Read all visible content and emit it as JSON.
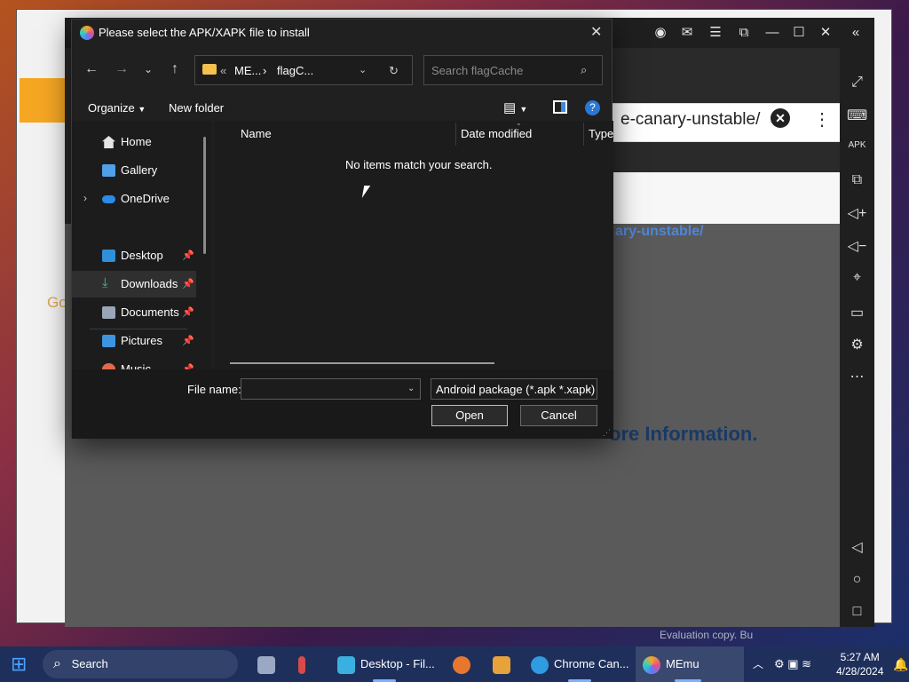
{
  "dialog": {
    "title": "Please select the APK/XAPK file to install",
    "close": "✕",
    "address": {
      "part1": "ME...",
      "part2": "flagC..."
    },
    "search_placeholder": "Search flagCache",
    "toolbar": {
      "organize": "Organize",
      "new_folder": "New folder"
    },
    "nav_items": [
      {
        "label": "Home"
      },
      {
        "label": "Gallery"
      },
      {
        "label": "OneDrive"
      },
      {
        "label": "Desktop"
      },
      {
        "label": "Downloads"
      },
      {
        "label": "Documents"
      },
      {
        "label": "Pictures"
      },
      {
        "label": "Music"
      }
    ],
    "columns": {
      "name": "Name",
      "date": "Date modified",
      "type": "Type"
    },
    "empty_message": "No items match your search.",
    "file_name_label": "File name:",
    "file_name_value": "",
    "file_type": "Android package (*.apk *.xapk)",
    "open": "Open",
    "cancel": "Cancel"
  },
  "memu": {
    "url_text": "e-canary-unstable/",
    "link_text": "ary-unstable/",
    "more_info": "ore Information.",
    "eval": "Evaluation copy. Bu"
  },
  "background": {
    "go_text": "Go"
  },
  "taskbar": {
    "search": "Search",
    "items": [
      "Desktop - Fil...",
      "Chrome Can...",
      "MEmu"
    ],
    "time": "5:27 AM",
    "date": "4/28/2024"
  }
}
